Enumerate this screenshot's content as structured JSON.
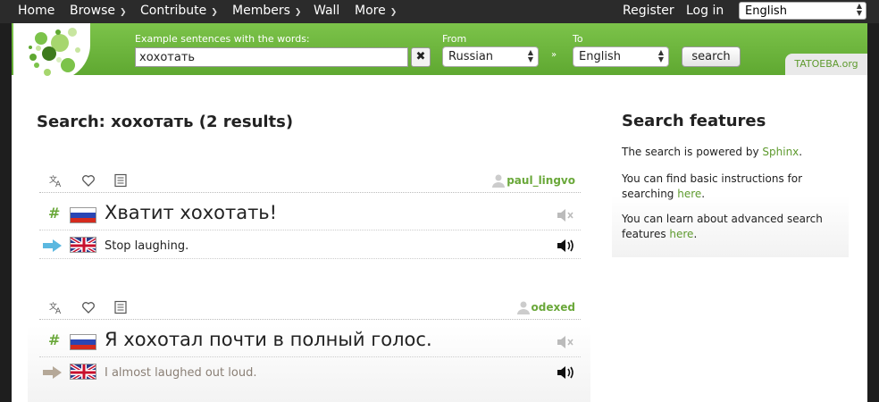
{
  "nav": {
    "items": [
      {
        "label": "Home",
        "dropdown": false
      },
      {
        "label": "Browse",
        "dropdown": true
      },
      {
        "label": "Contribute",
        "dropdown": true
      },
      {
        "label": "Members",
        "dropdown": true
      },
      {
        "label": "Wall",
        "dropdown": false
      },
      {
        "label": "More",
        "dropdown": true
      }
    ],
    "register": "Register",
    "login": "Log in",
    "interface_language": "English"
  },
  "search": {
    "label": "Example sentences with the words:",
    "query": "хохотать",
    "from_label": "From",
    "from_value": "Russian",
    "to_label": "To",
    "to_value": "English",
    "button": "search",
    "swap_icon": "»",
    "clear_icon": "✖"
  },
  "brand": "TATOEBA.org",
  "results": {
    "title": "Search: хохотать (2 results)",
    "items": [
      {
        "owner": "paul_lingvo",
        "hash": "#",
        "text": "Хватит хохотать!",
        "lang": "russian",
        "audio": "no-audio",
        "translation": {
          "text": "Stop laughing.",
          "lang": "english",
          "audio": "audio",
          "arrow_color": "#5bb8e0",
          "text_color": "#222222"
        }
      },
      {
        "owner": "odexed",
        "hash": "#",
        "text": "Я хохотал почти в полный голос.",
        "lang": "russian",
        "audio": "no-audio",
        "translation": {
          "text": "I almost laughed out loud.",
          "lang": "english",
          "audio": "audio",
          "arrow_color": "#b5a898",
          "text_color": "#8a7f75"
        }
      }
    ]
  },
  "sidebar": {
    "title": "Search features",
    "p1_before": "The search is powered by ",
    "p1_link": "Sphinx",
    "p1_after": ".",
    "p2_before": "You can find basic instructions for searching ",
    "p2_link": "here",
    "p2_after": ".",
    "p3_before": "You can learn about advanced search features ",
    "p3_link": "here",
    "p3_after": "."
  },
  "colors": {
    "accent_green": "#6aa83a",
    "header_green": "#5fa831",
    "nav_bg": "#2b2b2b"
  }
}
